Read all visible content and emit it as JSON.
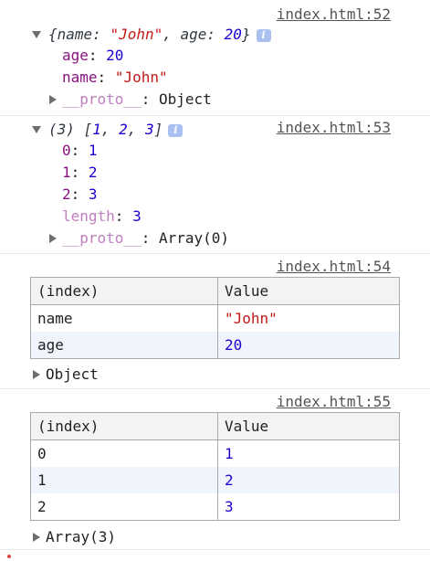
{
  "messages": [
    {
      "source": "index.html:52",
      "summary": {
        "open": "{",
        "k1": "name",
        "v1": "\"John\"",
        "sep": ", ",
        "k2": "age",
        "v2": "20",
        "close": "}",
        "badge": "i"
      },
      "props": [
        {
          "key": "age",
          "value": "20"
        },
        {
          "key": "name",
          "value": "\"John\""
        }
      ],
      "proto": {
        "key": "__proto__",
        "value": "Object"
      }
    },
    {
      "source": "index.html:53",
      "summary": {
        "count": "(3)",
        "open": "[",
        "items": [
          "1",
          "2",
          "3"
        ],
        "close": "]",
        "badge": "i"
      },
      "props": [
        {
          "key": "0",
          "value": "1"
        },
        {
          "key": "1",
          "value": "2"
        },
        {
          "key": "2",
          "value": "3"
        },
        {
          "key": "length",
          "value": "3"
        }
      ],
      "proto": {
        "key": "__proto__",
        "value": "Array(0)"
      }
    },
    {
      "source": "index.html:54",
      "table": {
        "headers": [
          "(index)",
          "Value"
        ],
        "rows": [
          {
            "index": "name",
            "value": "\"John\""
          },
          {
            "index": "age",
            "value": "20"
          }
        ]
      },
      "footer": "Object"
    },
    {
      "source": "index.html:55",
      "table": {
        "headers": [
          "(index)",
          "Value"
        ],
        "rows": [
          {
            "index": "0",
            "value": "1"
          },
          {
            "index": "1",
            "value": "2"
          },
          {
            "index": "2",
            "value": "3"
          }
        ]
      },
      "footer": "Array(3)"
    }
  ],
  "icons": {
    "expand": "triangle-down-icon",
    "collapsed": "triangle-right-icon",
    "info": "info-badge-icon"
  },
  "colors": {
    "property_key": "#881280",
    "number": "#1c00cf",
    "string": "#c41a16",
    "link": "#545454",
    "table_border": "#aaaaaa",
    "table_header_bg": "#f3f3f3",
    "table_alt_row_bg": "#f0f4fc"
  }
}
